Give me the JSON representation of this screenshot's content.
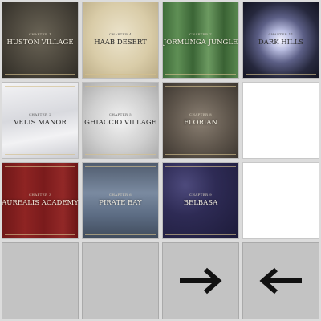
{
  "chapters": [
    {
      "chapter_label": "Chapter 1",
      "title": "HUSTON VILLAGE"
    },
    {
      "chapter_label": "Chapter 4",
      "title": "HAAB DESERT"
    },
    {
      "chapter_label": "Chapter 7",
      "title": "JORMUNGA JUNGLE"
    },
    {
      "chapter_label": "Chapter 11",
      "title": "DARK HILLS"
    },
    {
      "chapter_label": "Chapter 2",
      "title": "VELIS MANOR"
    },
    {
      "chapter_label": "Chapter 5",
      "title": "GHIACCIO VILLAGE"
    },
    {
      "chapter_label": "Chapter 8",
      "title": "FLORIAN"
    },
    {
      "chapter_label": "Chapter 3",
      "title": "AUREALIS ACADEMY"
    },
    {
      "chapter_label": "Chapter 6",
      "title": "PIRATE BAY"
    },
    {
      "chapter_label": "Chapter 9",
      "title": "BELBASA"
    }
  ],
  "navigation": {
    "next_icon": "arrow-right-icon",
    "prev_icon": "arrow-left-icon"
  },
  "colors": {
    "background": "#dcdcdc",
    "empty_slot": "#ffffff",
    "nav_slot": "#c3c3c3",
    "arrow": "#111111"
  }
}
